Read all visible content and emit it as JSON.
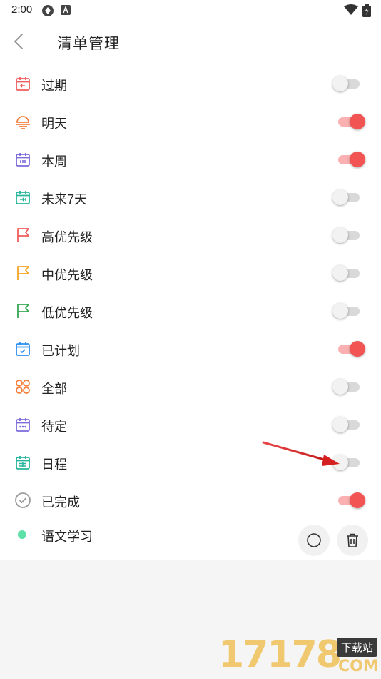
{
  "status_bar": {
    "time": "2:00"
  },
  "header": {
    "title": "清单管理"
  },
  "lists": [
    {
      "label": "过期",
      "icon": "calendar-overdue-icon",
      "color": "#f25c5c",
      "enabled": false
    },
    {
      "label": "明天",
      "icon": "sunset-icon",
      "color": "#f5803e",
      "enabled": true
    },
    {
      "label": "本周",
      "icon": "calendar-week-icon",
      "color": "#7b6bdb",
      "enabled": true
    },
    {
      "label": "未来7天",
      "icon": "calendar-next-icon",
      "color": "#26b59a",
      "enabled": false
    },
    {
      "label": "高优先级",
      "icon": "flag-high-icon",
      "color": "#f25c5c",
      "enabled": false
    },
    {
      "label": "中优先级",
      "icon": "flag-medium-icon",
      "color": "#f5a623",
      "enabled": false
    },
    {
      "label": "低优先级",
      "icon": "flag-low-icon",
      "color": "#35a853",
      "enabled": false
    },
    {
      "label": "已计划",
      "icon": "calendar-check-icon",
      "color": "#2b8ff0",
      "enabled": true
    },
    {
      "label": "全部",
      "icon": "grid-circles-icon",
      "color": "#f5803e",
      "enabled": false
    },
    {
      "label": "待定",
      "icon": "calendar-dots-icon",
      "color": "#7b6bdb",
      "enabled": false
    },
    {
      "label": "日程",
      "icon": "calendar-schedule-icon",
      "color": "#26b59a",
      "enabled": false
    },
    {
      "label": "已完成",
      "icon": "check-circle-icon",
      "color": "#9a9a9a",
      "enabled": true
    }
  ],
  "custom_list": {
    "label": "语文学习",
    "dot_color": "#5fe0a8"
  },
  "watermark": {
    "digits": "17178",
    "badge": "下载站",
    "domain": "COM"
  },
  "accent_color": "#f25454"
}
